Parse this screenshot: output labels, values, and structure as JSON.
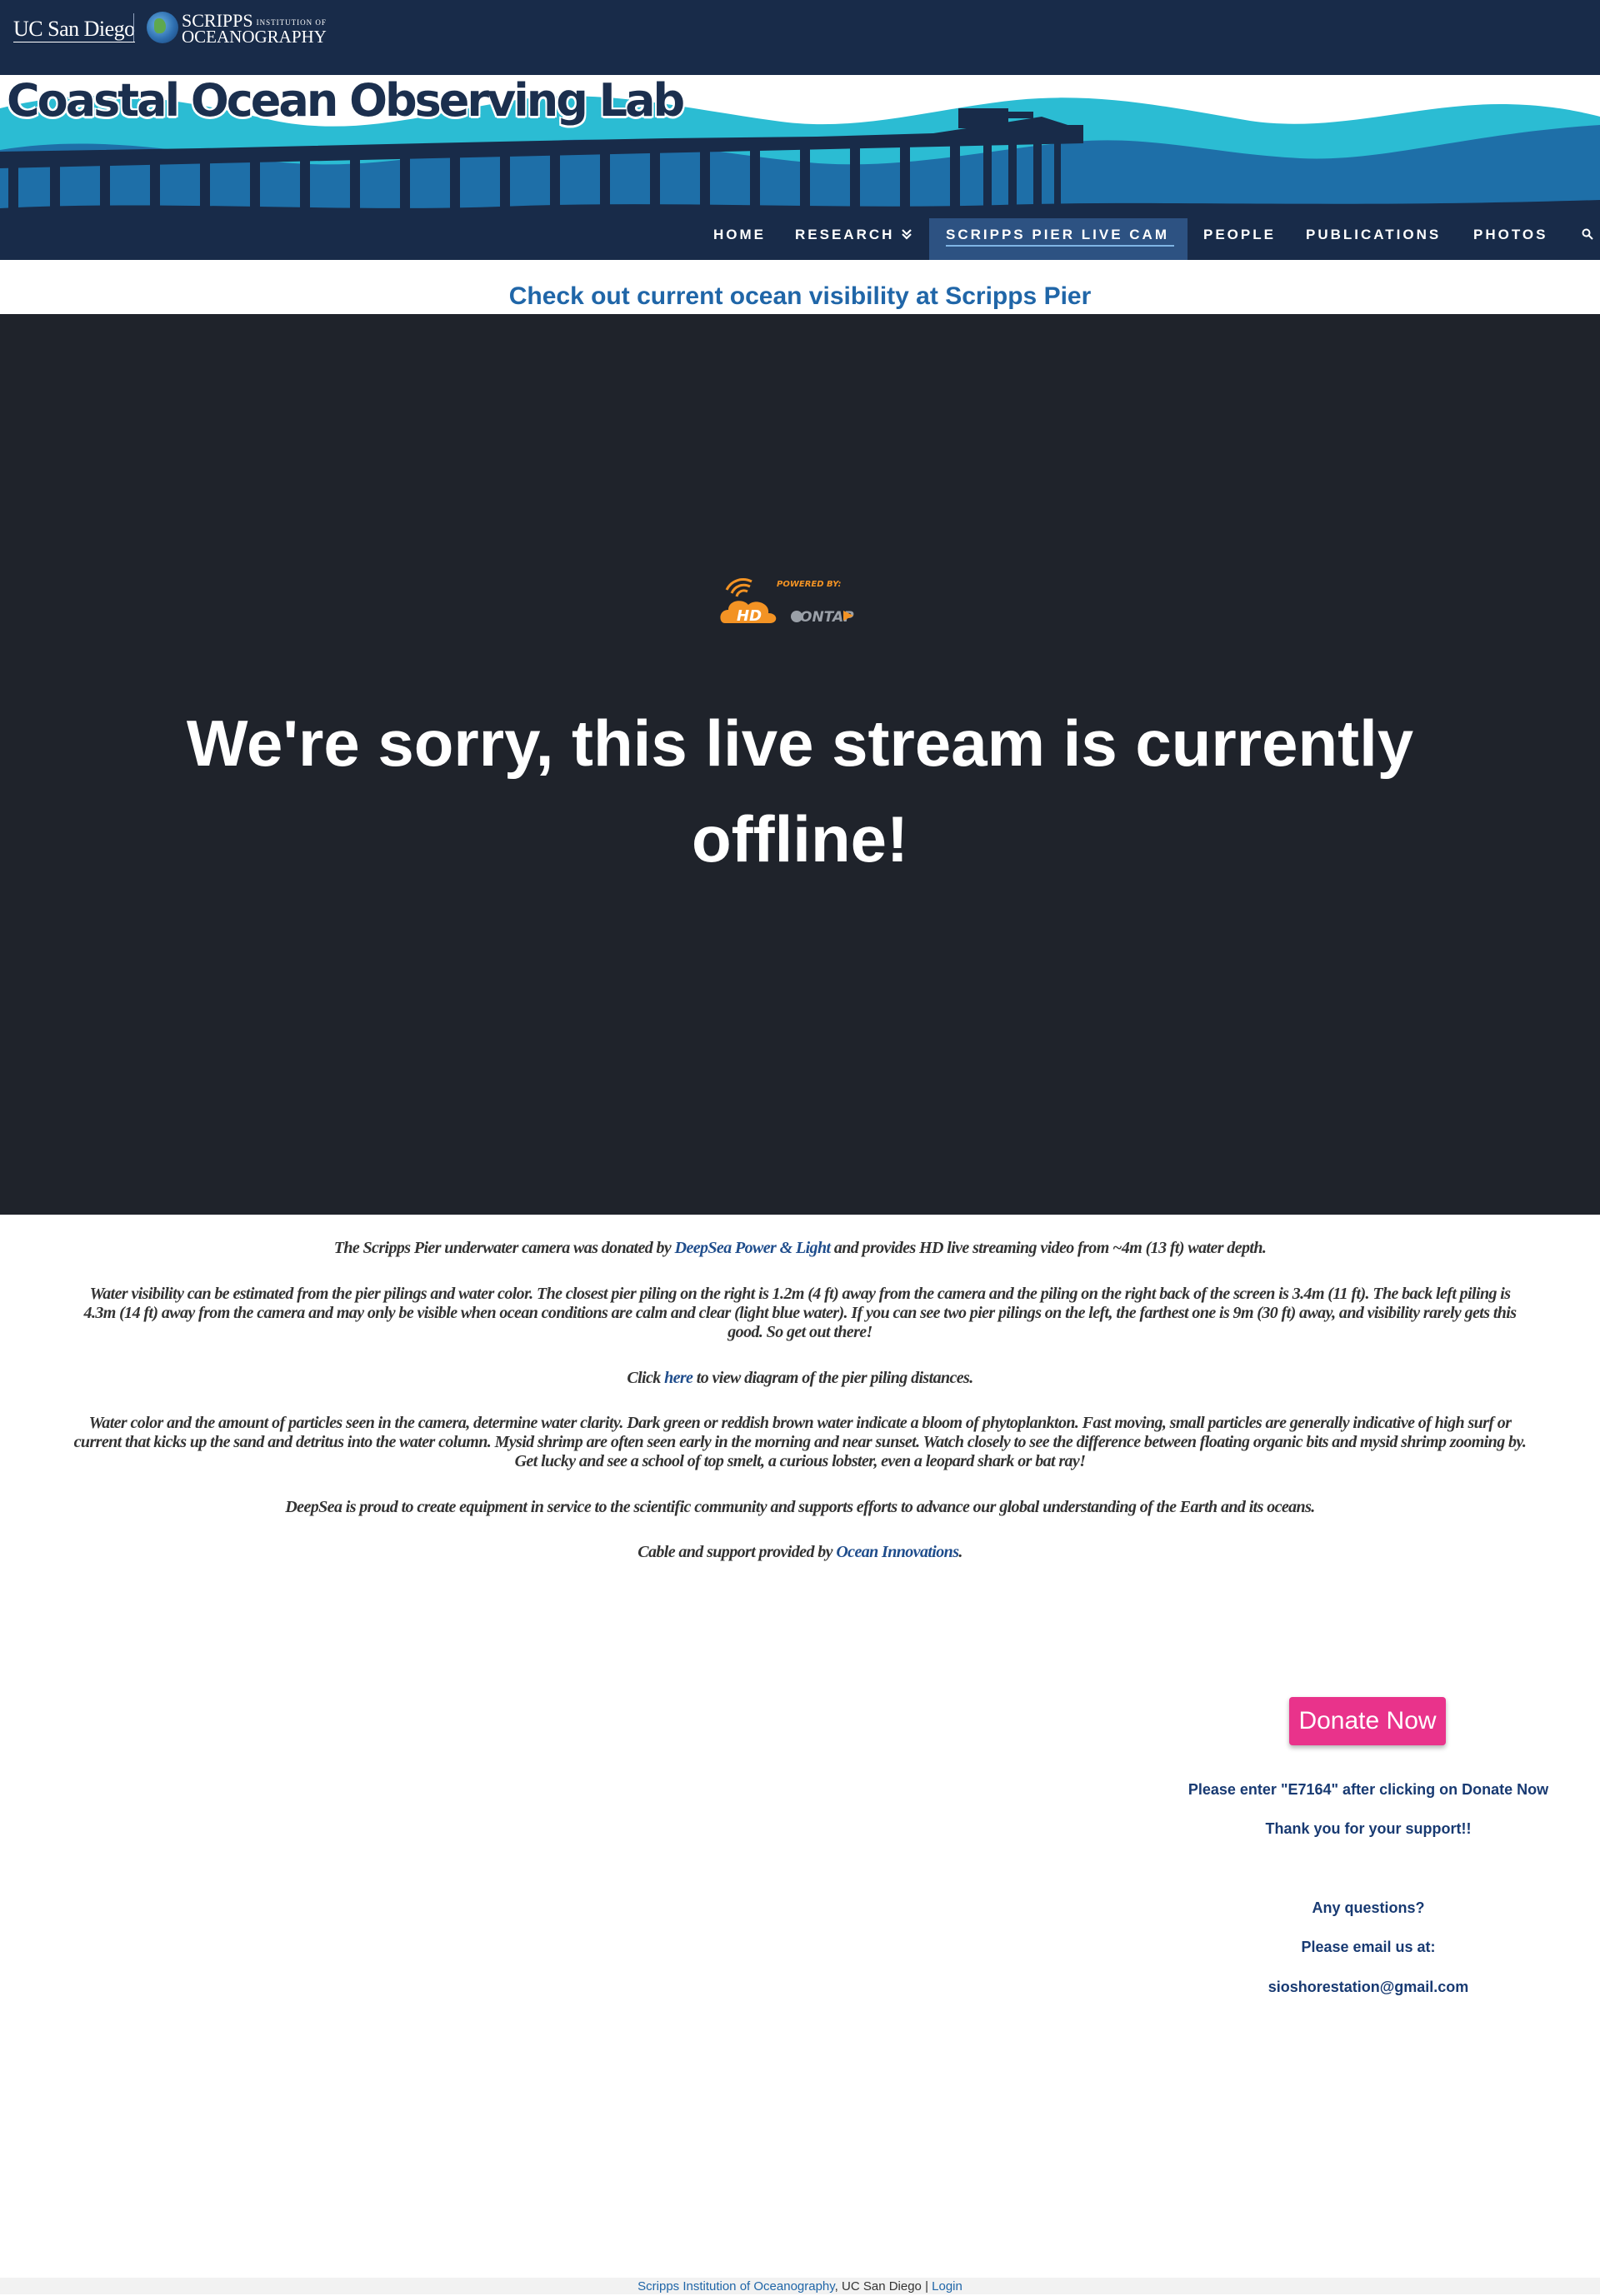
{
  "header": {
    "ucsd_logo": "UC San Diego",
    "sio_logo_line1": "SCRIPPS",
    "sio_logo_small": "INSTITUTION OF",
    "sio_logo_line2": "OCEANOGRAPHY"
  },
  "site": {
    "title": "Coastal Ocean Observing Lab",
    "colors": {
      "navy": "#182b49",
      "aqua": "#2bbcd3",
      "blue": "#1e6fa8",
      "accent_pink": "#e9338b",
      "link_blue": "#2066a8"
    }
  },
  "nav": {
    "items": [
      {
        "label": "HOME"
      },
      {
        "label": "RESEARCH",
        "icon": "double-chevron-down-icon"
      },
      {
        "label": "SCRIPPS PIER LIVE CAM",
        "active": true
      },
      {
        "label": "PEOPLE"
      },
      {
        "label": "PUBLICATIONS"
      },
      {
        "label": "PHOTOS"
      }
    ],
    "search_icon": "search-icon"
  },
  "visibility_headline": "Check out current ocean visibility at Scripps Pier",
  "player": {
    "logo_powered": "POWERED BY:",
    "logo_hd": "HD",
    "logo_ontap": "ONTAP",
    "offline_line1": "We're sorry, this live stream is currently",
    "offline_line2": "offline!"
  },
  "content": {
    "p1_a": "The Scripps Pier underwater camera was donated by ",
    "p1_link": "DeepSea Power & Light",
    "p1_b": " and provides HD live streaming video from ~4m (13 ft) water depth.",
    "p2_l1": "Water visibility can be estimated  from the pier pilings and water color. The closest  pier piling on the right is  1.2m (4 ft)  away from the camera and the piling on the right back of the screen is 3.4m (11 ft). The back left piling is",
    "p2_l2": "4.3m (14 ft) away from the camera and  may only be visible when ocean conditions are calm and clear (light blue water).  If you can  see two pier pilings on the left, the farthest one  is 9m (30 ft) away, and visibility rarely gets this",
    "p2_l3": "good. So get out there!",
    "p3_a": "Click ",
    "p3_link": "here",
    "p3_b": " to view diagram of the pier piling distances.",
    "p4_l1": "Water color and the amount of particles seen in the camera, determine water clarity. Dark green or reddish  brown water indicate a bloom of phytoplankton. Fast moving, small particles are generally indicative of high surf or",
    "p4_l2": "current that kicks up the sand  and detritus into the water column. Mysid shrimp are often seen early in the morning and near sunset. Watch closely to see the difference between floating organic bits and mysid shrimp zooming by.",
    "p4_l3": "Get lucky and see a school of top smelt, a curious lobster, even a leopard shark or bat ray!",
    "p5": "DeepSea is proud to create equipment in service to the scientific community and supports efforts to advance our global understanding of the Earth and its oceans.",
    "p6_a": "Cable and support provided by ",
    "p6_link": "Ocean Innovations",
    "p6_b": "."
  },
  "sidebar": {
    "donate_label": "Donate Now",
    "code_note": "Please enter \"E7164\"  after clicking on Donate Now",
    "thanks": "Thank you for your support!!",
    "questions": "Any questions?",
    "email_prompt": "Please email us at:",
    "email": "sioshorestation@gmail.com"
  },
  "footer": {
    "link1": "Scripps Institution of Oceanography",
    "sep1": ", ",
    "text2": "UC San Diego",
    "sep2": " | ",
    "link2": "Login"
  }
}
